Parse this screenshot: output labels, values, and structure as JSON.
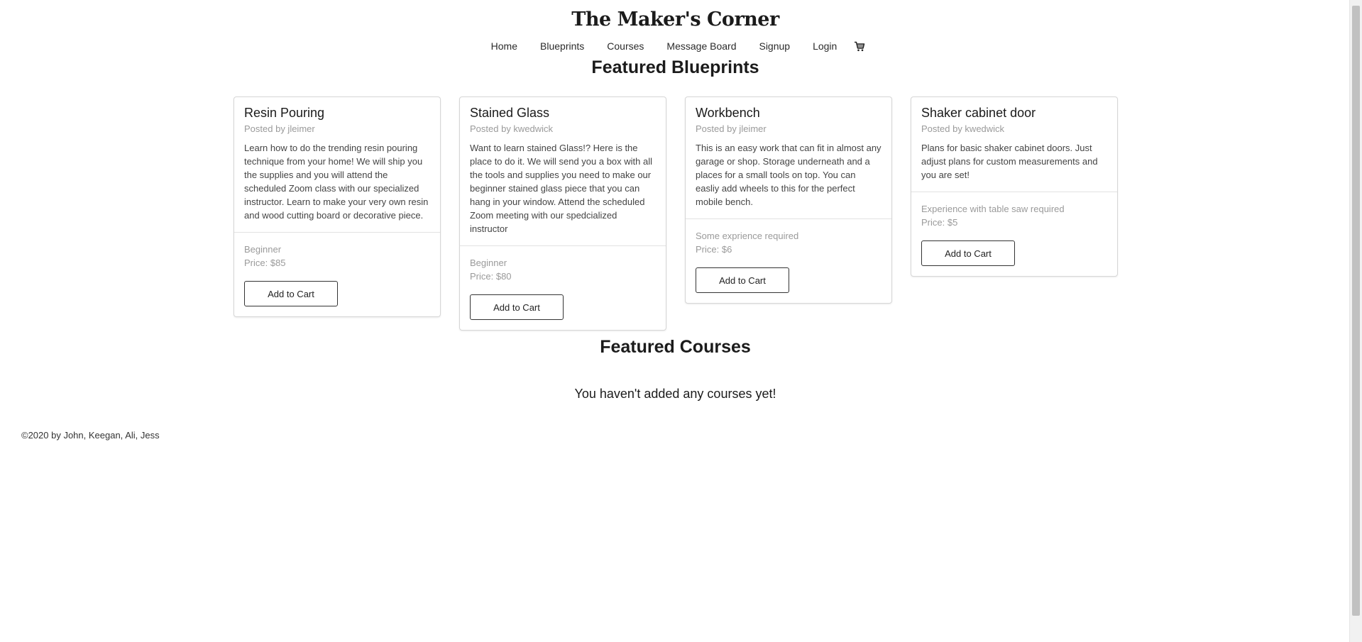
{
  "site": {
    "title": "The Maker's Corner"
  },
  "nav": {
    "items": [
      "Home",
      "Blueprints",
      "Courses",
      "Message Board",
      "Signup",
      "Login"
    ],
    "cart_icon": "cart-icon"
  },
  "blueprints": {
    "heading": "Featured Blueprints",
    "cards": [
      {
        "title": "Resin Pouring",
        "author": "Posted by jleimer",
        "description": "Learn how to do the trending resin pouring technique from your home! We will ship you the supplies and you will attend the scheduled Zoom class with our specialized instructor. Learn to make your very own resin and wood cutting board or decorative piece.",
        "level": "Beginner",
        "price": "Price: $85",
        "button": "Add to Cart"
      },
      {
        "title": "Stained Glass",
        "author": "Posted by kwedwick",
        "description": "Want to learn stained Glass!? Here is the place to do it. We will send you a box with all the tools and supplies you need to make our beginner stained glass piece that you can hang in your window. Attend the scheduled Zoom meeting with our spedcialized instructor",
        "level": "Beginner",
        "price": "Price: $80",
        "button": "Add to Cart"
      },
      {
        "title": "Workbench",
        "author": "Posted by jleimer",
        "description": "This is an easy work that can fit in almost any garage or shop. Storage underneath and a places for a small tools on top. You can easliy add wheels to this for the perfect mobile bench.",
        "level": "Some exprience required",
        "price": "Price: $6",
        "button": "Add to Cart"
      },
      {
        "title": "Shaker cabinet door",
        "author": "Posted by kwedwick",
        "description": "Plans for basic shaker cabinet doors. Just adjust plans for custom measurements and you are set!",
        "level": "Experience with table saw required",
        "price": "Price: $5",
        "button": "Add to Cart"
      }
    ]
  },
  "courses": {
    "heading": "Featured Courses",
    "empty_message": "You haven't added any courses yet!"
  },
  "footer": {
    "text": "©2020 by John, Keegan, Ali, Jess"
  }
}
